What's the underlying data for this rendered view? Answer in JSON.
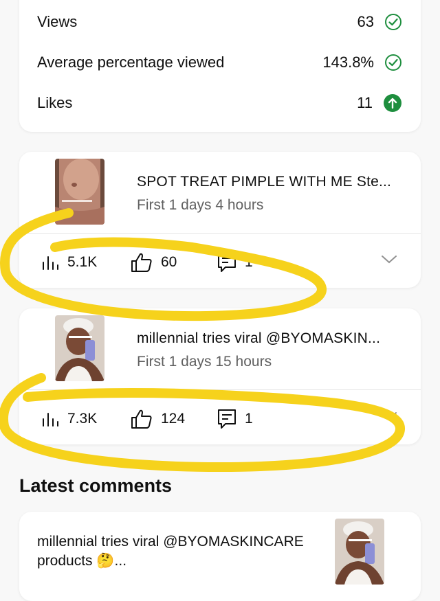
{
  "stats": {
    "rows": [
      {
        "label": "Views",
        "value": "63",
        "icon": "check-circle-icon"
      },
      {
        "label": "Average percentage viewed",
        "value": "143.8%",
        "icon": "check-circle-icon"
      },
      {
        "label": "Likes",
        "value": "11",
        "icon": "arrow-up-circle-icon"
      }
    ]
  },
  "videos": [
    {
      "title": "SPOT TREAT PIMPLE WITH ME Ste...",
      "subtitle": "First 1 days 4 hours",
      "views": "5.1K",
      "likes": "60",
      "comments": "1"
    },
    {
      "title": "millennial tries viral @BYOMASKIN...",
      "subtitle": "First 1 days 15 hours",
      "views": "7.3K",
      "likes": "124",
      "comments": "1"
    }
  ],
  "latest_comments": {
    "heading": "Latest comments",
    "items": [
      {
        "text": "millennial tries viral @BYOMASKINCARE products 🤔..."
      }
    ]
  },
  "colors": {
    "accent_green": "#1e8e3e",
    "highlight_yellow": "#f6d21c",
    "background": "#f8f8f8"
  }
}
